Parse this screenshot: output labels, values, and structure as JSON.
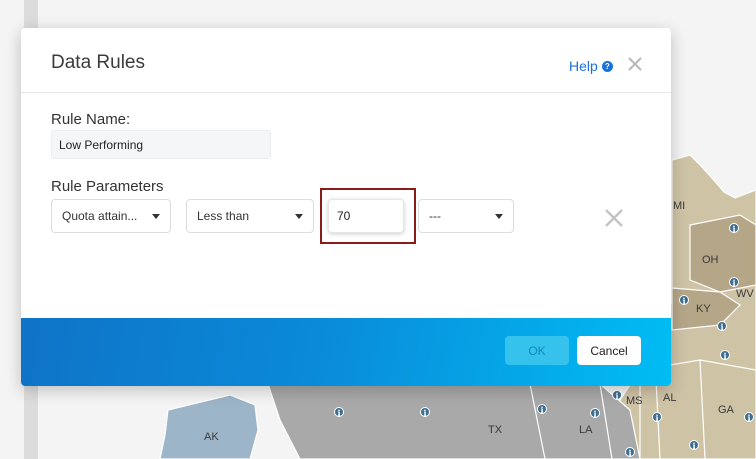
{
  "map": {
    "state_labels": [
      "MI",
      "OH",
      "KY",
      "WV",
      "MS",
      "AL",
      "GA",
      "AK",
      "TX",
      "LA"
    ],
    "pin_icon": "info-icon"
  },
  "dialog": {
    "title": "Data Rules",
    "help_label": "Help",
    "help_icon": "question-circle-icon",
    "close_icon": "close-icon",
    "rule_name_label": "Rule Name:",
    "rule_name_value": "Low Performing",
    "rule_parameters_label": "Rule Parameters",
    "field_select": "Quota attain...",
    "operator_select": "Less than",
    "value": "70",
    "secondary_select": "---",
    "remove_icon": "remove-x-icon",
    "ok_label": "OK",
    "cancel_label": "Cancel"
  },
  "colors": {
    "accent": "#1a72d9",
    "footer_start": "#0f73c7",
    "footer_end": "#00bdf4",
    "highlight": "#8b1b1b"
  }
}
